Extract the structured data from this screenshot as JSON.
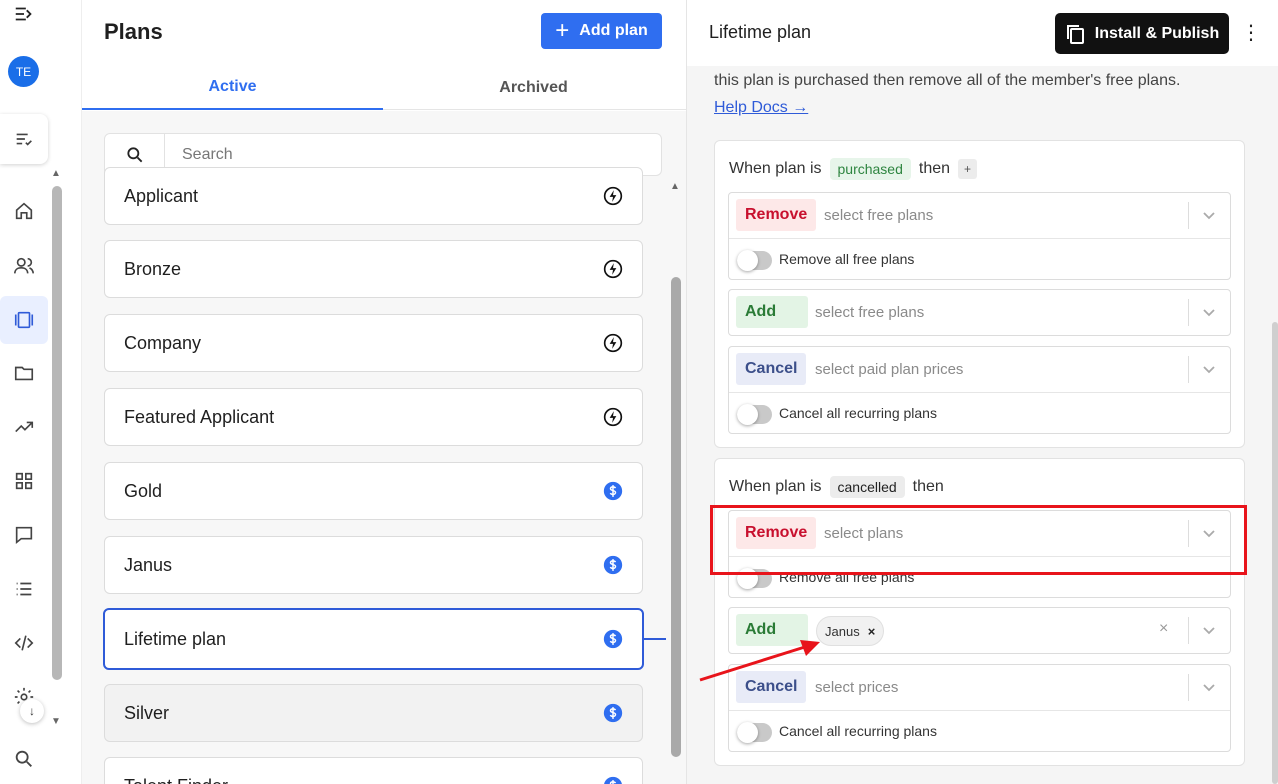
{
  "rail": {
    "avatar_initials": "TE"
  },
  "plans": {
    "title": "Plans",
    "add_label": "Add plan",
    "tabs": [
      {
        "label": "Active",
        "active": true
      },
      {
        "label": "Archived",
        "active": false
      }
    ],
    "search_placeholder": "Search",
    "items": [
      {
        "name": "Applicant",
        "icon": "bolt-icon"
      },
      {
        "name": "Bronze",
        "icon": "bolt-icon"
      },
      {
        "name": "Company",
        "icon": "bolt-icon"
      },
      {
        "name": "Featured Applicant",
        "icon": "bolt-icon"
      },
      {
        "name": "Gold",
        "icon": "dollar-icon"
      },
      {
        "name": "Janus",
        "icon": "dollar-icon"
      },
      {
        "name": "Lifetime plan",
        "icon": "dollar-icon",
        "selected": true
      },
      {
        "name": "Silver",
        "icon": "dollar-icon"
      },
      {
        "name": "Talent Finder",
        "icon": "dollar-icon"
      }
    ]
  },
  "detail": {
    "title": "Lifetime plan",
    "publish_label": "Install & Publish",
    "description": "this plan is purchased then remove all of the member's free plans.",
    "help_link": "Help Docs →",
    "rule_purchased": {
      "prefix": "When plan is",
      "event": "purchased",
      "suffix": "then",
      "plus": "+",
      "remove": {
        "action": "Remove",
        "placeholder": "select free plans",
        "toggle_label": "Remove all free plans"
      },
      "add": {
        "action": "Add",
        "placeholder": "select free plans"
      },
      "cancel": {
        "action": "Cancel",
        "placeholder": "select paid plan prices",
        "toggle_label": "Cancel all recurring plans"
      }
    },
    "rule_cancelled": {
      "prefix": "When plan is",
      "event": "cancelled",
      "suffix": "then",
      "remove": {
        "action": "Remove",
        "placeholder": "select plans",
        "toggle_label": "Remove all free plans"
      },
      "add": {
        "action": "Add",
        "chip": "Janus",
        "chip_remove": "×",
        "clear": "×"
      },
      "cancel": {
        "action": "Cancel",
        "placeholder": "select prices",
        "toggle_label": "Cancel all recurring plans"
      }
    }
  },
  "colors": {
    "accent": "#2f6ef0",
    "remove": "#c8102e",
    "add": "#2a7b36",
    "cancel": "#3c4f8a",
    "annotation": "#e8141b"
  }
}
